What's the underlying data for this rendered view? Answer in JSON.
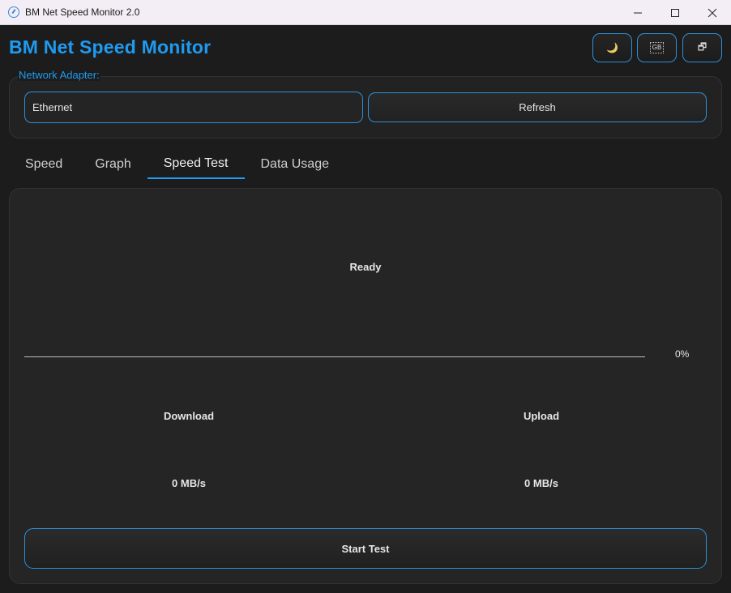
{
  "window": {
    "title": "BM Net Speed Monitor 2.0",
    "controls": {
      "minimize": "—",
      "maximize": "☐",
      "close": "✕"
    }
  },
  "header": {
    "app_title": "BM Net Speed Monitor",
    "buttons": {
      "theme_icon": "moon-icon",
      "theme_glyph": "🌙",
      "unit_label": "GB",
      "mini_icon": "restore-window-icon",
      "mini_glyph": "🗗"
    }
  },
  "adapter": {
    "label": "Network Adapter:",
    "selected": "Ethernet",
    "refresh_label": "Refresh"
  },
  "tabs": [
    {
      "label": "Speed",
      "active": false
    },
    {
      "label": "Graph",
      "active": false
    },
    {
      "label": "Speed Test",
      "active": true
    },
    {
      "label": "Data Usage",
      "active": false
    }
  ],
  "speed_test": {
    "status": "Ready",
    "progress_percent": 0,
    "progress_label": "0%",
    "download": {
      "label": "Download",
      "value": "0 MB/s"
    },
    "upload": {
      "label": "Upload",
      "value": "0 MB/s"
    },
    "start_label": "Start Test"
  },
  "colors": {
    "accent": "#1e9bf0",
    "background": "#1c1c1c",
    "panel": "#252525",
    "text": "#e6e6e6"
  }
}
